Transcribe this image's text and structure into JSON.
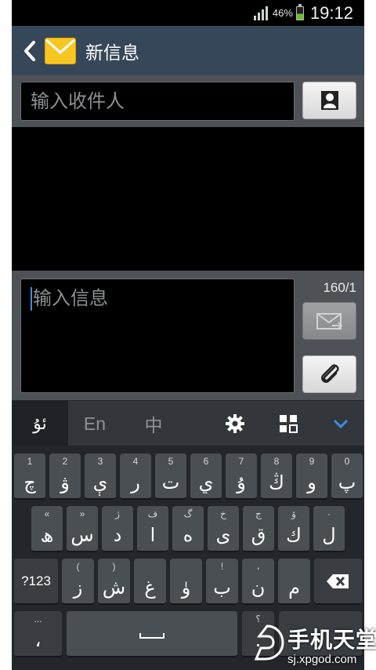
{
  "status_bar": {
    "battery_percent": "46%",
    "time": "19:12",
    "icons": [
      "signal-icon",
      "battery-charging-icon"
    ]
  },
  "header": {
    "back_icon": "back-arrow-icon",
    "app_icon": "envelope-icon",
    "title": "新信息"
  },
  "recipient": {
    "placeholder": "输入收件人",
    "contact_icon": "contact-icon"
  },
  "compose": {
    "placeholder": "输入信息",
    "char_counter": "160/1",
    "send_icon": "send-message-icon",
    "attach_icon": "paperclip-icon"
  },
  "keyboard_toolbar": {
    "language_uyghur": "ئۇ",
    "language_en": "En",
    "language_zh": "中",
    "icons": [
      "settings-gear-icon",
      "grid-icon",
      "collapse-chevron-icon"
    ]
  },
  "keyboard": {
    "row1": [
      {
        "hint": "1",
        "label": "چ"
      },
      {
        "hint": "2",
        "label": "ۋ"
      },
      {
        "hint": "3",
        "label": "ې"
      },
      {
        "hint": "4",
        "label": "ر"
      },
      {
        "hint": "5",
        "label": "ت"
      },
      {
        "hint": "6",
        "label": "ي"
      },
      {
        "hint": "7",
        "label": "ۇ"
      },
      {
        "hint": "8",
        "label": "ڭ"
      },
      {
        "hint": "9",
        "label": "و"
      },
      {
        "hint": "0",
        "label": "پ"
      }
    ],
    "row2": [
      {
        "hint": "«",
        "label": "ھ"
      },
      {
        "hint": "»",
        "label": "س"
      },
      {
        "hint": "ژ",
        "label": "د"
      },
      {
        "hint": "ف",
        "label": "ا"
      },
      {
        "hint": "گ",
        "label": "ە"
      },
      {
        "hint": "خ",
        "label": "ى"
      },
      {
        "hint": "ج",
        "label": "ق"
      },
      {
        "hint": "ۆ",
        "label": "ك"
      },
      {
        "hint": "·",
        "label": "ل"
      }
    ],
    "row3": [
      {
        "hint": "",
        "label": "?123"
      },
      {
        "hint": "(",
        "label": "ز"
      },
      {
        "hint": ")",
        "label": "ش"
      },
      {
        "hint": "",
        "label": "غ"
      },
      {
        "hint": "",
        "label": "ۈ"
      },
      {
        "hint": "!",
        "label": "ب"
      },
      {
        "hint": "،",
        "label": "ن"
      },
      {
        "hint": "",
        "label": "م"
      },
      {
        "hint": "",
        "label": "backspace"
      }
    ],
    "row4": [
      {
        "hint": "...",
        "label": "،"
      },
      {
        "hint": "",
        "label": "space"
      },
      {
        "hint": "؟",
        "label": "."
      }
    ]
  },
  "watermark": {
    "brand": "手机天堂",
    "url": "sj.xpgod.com"
  }
}
